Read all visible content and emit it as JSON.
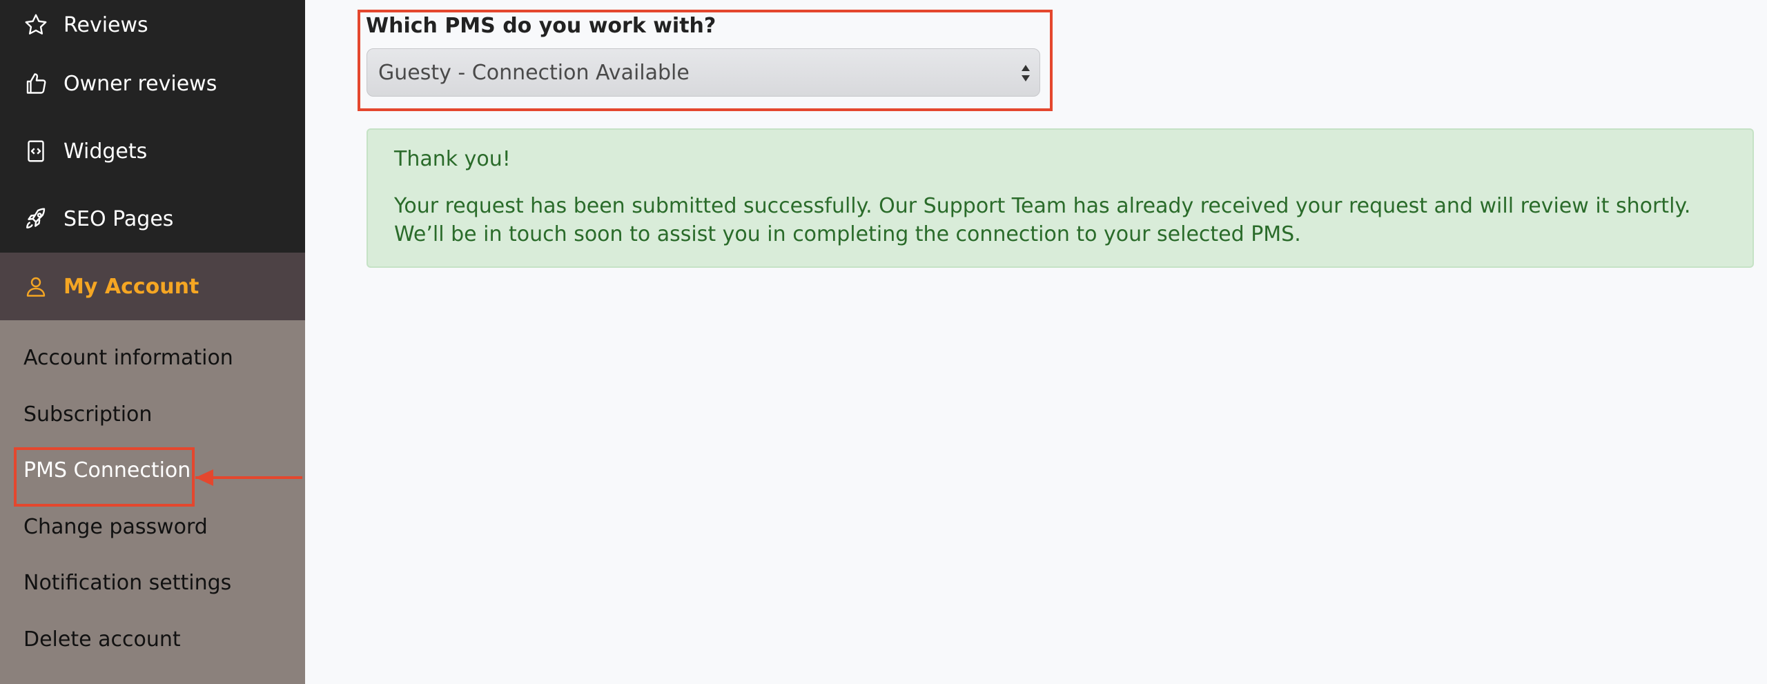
{
  "sidebar": {
    "main_items": [
      {
        "label": "Reviews",
        "icon": "star-icon"
      },
      {
        "label": "Owner reviews",
        "icon": "thumbs-up-icon"
      },
      {
        "label": "Widgets",
        "icon": "code-file-icon"
      },
      {
        "label": "SEO Pages",
        "icon": "rocket-icon"
      }
    ],
    "active_section": {
      "label": "My Account",
      "icon": "user-icon"
    },
    "sub_items": [
      {
        "label": "Account information"
      },
      {
        "label": "Subscription"
      },
      {
        "label": "PMS Connection"
      },
      {
        "label": "Change password"
      },
      {
        "label": "Notification settings"
      },
      {
        "label": "Delete account"
      }
    ]
  },
  "pms": {
    "question": "Which PMS do you work with?",
    "selected_value": "Guesty - Connection Available"
  },
  "alert": {
    "title": "Thank you!",
    "body": "Your request has been submitted successfully. Our Support Team has already received your request and will review it shortly. We’ll be in touch soon to assist you in completing the connection to your selected PMS."
  },
  "colors": {
    "accent": "#f5a623",
    "highlight": "#e4472e",
    "success_text": "#2a6b2a",
    "success_bg": "#d9ecd9"
  }
}
